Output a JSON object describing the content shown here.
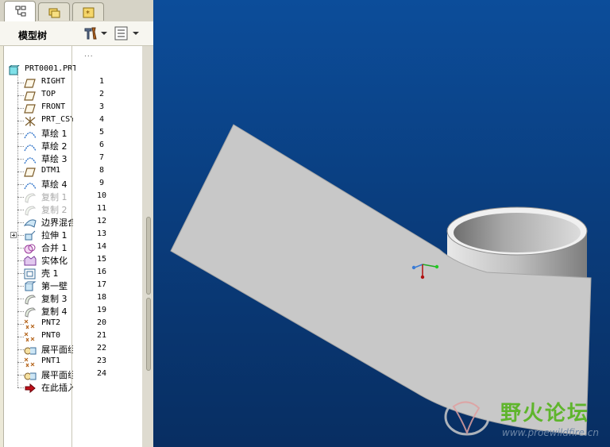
{
  "panel": {
    "title": "模型树",
    "column_dots": "...",
    "root": "PRT0001.PRT"
  },
  "tree_items": [
    {
      "label": "RIGHT",
      "num": "1",
      "icon": "datum-plane-icon",
      "grey": false,
      "cjk": false
    },
    {
      "label": "TOP",
      "num": "2",
      "icon": "datum-plane-icon",
      "grey": false,
      "cjk": false
    },
    {
      "label": "FRONT",
      "num": "3",
      "icon": "datum-plane-icon",
      "grey": false,
      "cjk": false
    },
    {
      "label": "PRT_CSYS_DEF",
      "num": "4",
      "icon": "csys-icon",
      "grey": false,
      "cjk": false
    },
    {
      "label": "草绘 1",
      "num": "5",
      "icon": "sketch-icon",
      "grey": false,
      "cjk": true
    },
    {
      "label": "草绘 2",
      "num": "6",
      "icon": "sketch-icon",
      "grey": false,
      "cjk": true
    },
    {
      "label": "草绘 3",
      "num": "7",
      "icon": "sketch-icon",
      "grey": false,
      "cjk": true
    },
    {
      "label": "DTM1",
      "num": "8",
      "icon": "datum-plane-icon",
      "grey": false,
      "cjk": false
    },
    {
      "label": "草绘 4",
      "num": "9",
      "icon": "sketch-icon",
      "grey": false,
      "cjk": true
    },
    {
      "label": "复制 1",
      "num": "10",
      "icon": "copy-surface-icon",
      "grey": true,
      "cjk": true
    },
    {
      "label": "复制 2",
      "num": "11",
      "icon": "copy-surface-icon",
      "grey": true,
      "cjk": true
    },
    {
      "label": "边界混合",
      "num": "12",
      "icon": "boundary-blend-icon",
      "grey": false,
      "cjk": true
    },
    {
      "label": "拉伸 1",
      "num": "13",
      "icon": "extrude-icon",
      "grey": false,
      "cjk": true
    },
    {
      "label": "合并 1",
      "num": "14",
      "icon": "merge-icon",
      "grey": false,
      "cjk": true
    },
    {
      "label": "实体化",
      "num": "15",
      "icon": "solidify-icon",
      "grey": false,
      "cjk": true
    },
    {
      "label": "壳 1",
      "num": "16",
      "icon": "shell-icon",
      "grey": false,
      "cjk": true
    },
    {
      "label": "第一壁",
      "num": "17",
      "icon": "first-wall-icon",
      "grey": false,
      "cjk": true
    },
    {
      "label": "复制 3",
      "num": "18",
      "icon": "copy-surface-icon",
      "grey": false,
      "cjk": true
    },
    {
      "label": "复制 4",
      "num": "19",
      "icon": "copy-surface-icon",
      "grey": false,
      "cjk": true
    },
    {
      "label": "PNT2",
      "num": "20",
      "icon": "datum-point-icon",
      "grey": false,
      "cjk": false
    },
    {
      "label": "PNT0",
      "num": "21",
      "icon": "datum-point-icon",
      "grey": false,
      "cjk": false
    },
    {
      "label": "展平面组",
      "num": "22",
      "icon": "flatten-quilt-icon",
      "grey": false,
      "cjk": true
    },
    {
      "label": "PNT1",
      "num": "23",
      "icon": "datum-point-icon",
      "grey": false,
      "cjk": false
    },
    {
      "label": "展平面组",
      "num": "24",
      "icon": "flatten-quilt-icon",
      "grey": false,
      "cjk": true
    },
    {
      "label": "在此插入",
      "num": "",
      "icon": "insert-here-arrow-icon",
      "grey": false,
      "cjk": true
    }
  ],
  "watermark": {
    "title": "野火论坛",
    "url": "www.proewildfire.cn"
  },
  "colors": {
    "viewport_top": "#0c4d9a",
    "viewport_bottom": "#082e62",
    "surface": "#c8c8c8",
    "watermark_green": "#5fb52c"
  }
}
